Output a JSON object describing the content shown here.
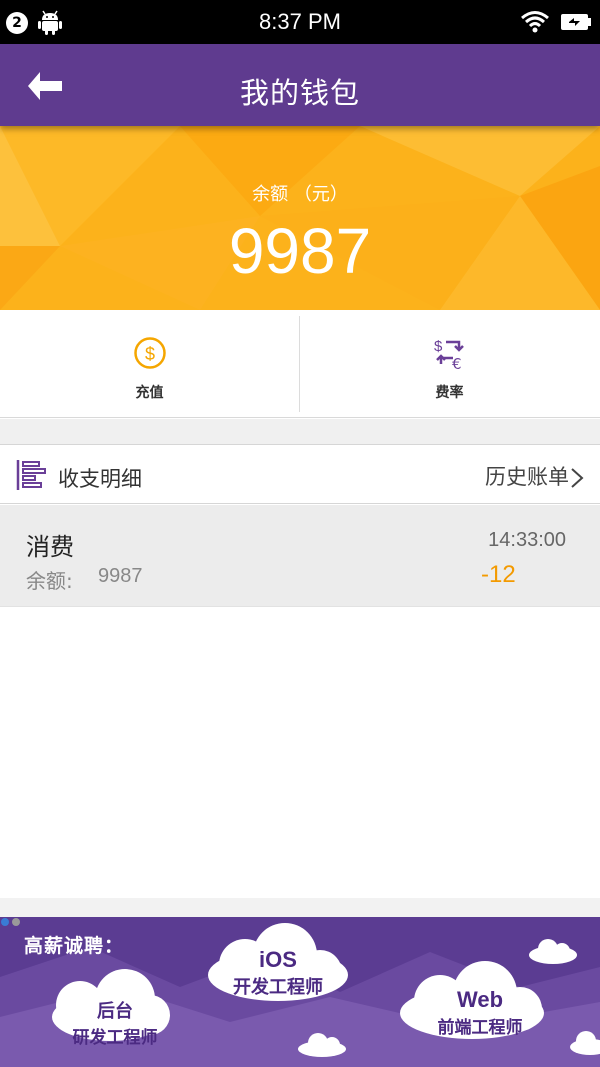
{
  "status_bar": {
    "notification_count": "2",
    "time": "8:37 PM",
    "icons": [
      "android-icon",
      "wifi-icon",
      "battery-charging-icon"
    ]
  },
  "app_bar": {
    "title": "我的钱包",
    "back_icon": "arrow-left-icon",
    "color": "#5f3b8f"
  },
  "balance": {
    "label": "余额 （元）",
    "value": "9987",
    "color": "#fcb21b"
  },
  "actions": [
    {
      "label": "充值",
      "icon": "dollar-coin-icon"
    },
    {
      "label": "费率",
      "icon": "currency-exchange-icon"
    }
  ],
  "ledger": {
    "title": "收支明细",
    "history_link": "历史账单",
    "transactions": [
      {
        "type": "消费",
        "balance_label": "余额:",
        "balance_value": "9987",
        "time": "14:33:00",
        "amount": "-12"
      }
    ]
  },
  "banner": {
    "headline": "高薪诚聘：",
    "bubbles": [
      {
        "line1": "后台",
        "line2": "研发工程师"
      },
      {
        "line1": "iOS",
        "line2": "开发工程师"
      },
      {
        "line1": "Web",
        "line2": "前端工程师"
      }
    ],
    "page_indicator": {
      "pages": 2,
      "active": 1
    }
  },
  "colors": {
    "accent_purple": "#5f3b8f",
    "balance_yellow": "#fcb21b",
    "amount_orange": "#f39a00"
  }
}
